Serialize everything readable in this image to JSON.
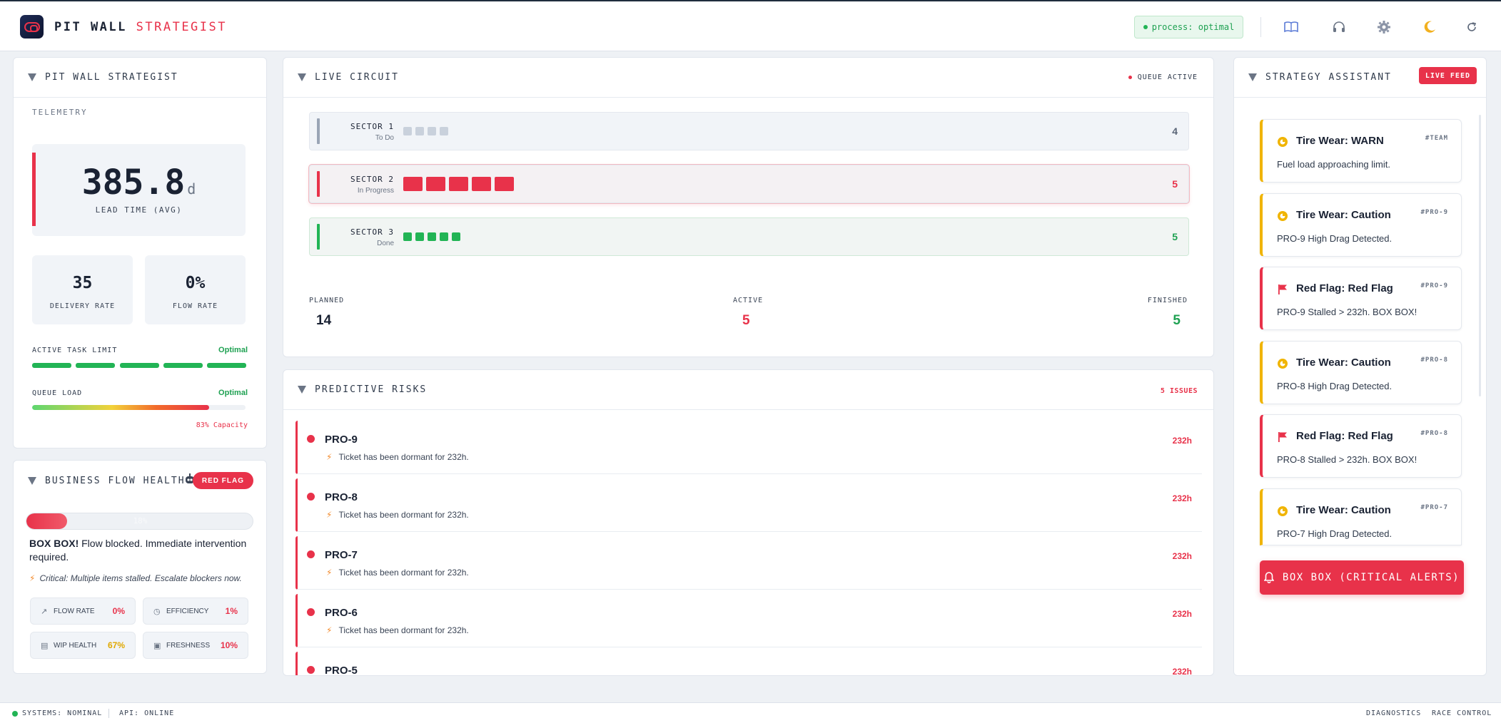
{
  "header": {
    "brand_part1": "PIT WALL",
    "brand_part2": "STRATEGIST",
    "status": "process: optimal"
  },
  "left": {
    "title": "PIT WALL STRATEGIST",
    "telemetry_label": "TELEMETRY",
    "lead_time_value": "385.8",
    "lead_time_unit": "d",
    "lead_time_label": "LEAD TIME (AVG)",
    "delivery_rate_value": "35",
    "delivery_rate_label": "DELIVERY RATE",
    "flow_rate_value": "0%",
    "flow_rate_label": "FLOW RATE",
    "active_task_label": "ACTIVE TASK LIMIT",
    "active_task_status": "Optimal",
    "queue_load_label": "QUEUE LOAD",
    "queue_load_status": "Optimal",
    "queue_capacity_text": "83% Capacity",
    "queue_capacity_fraction": 0.83
  },
  "business": {
    "title": "BUSINESS FLOW HEALTH",
    "badge": "RED FLAG",
    "progress_fraction": 0.18,
    "progress_text": "18%",
    "alert_bold": "BOX BOX!",
    "alert_text": "Flow blocked. Immediate intervention required.",
    "critical_text": "Critical: Multiple items stalled. Escalate blockers now.",
    "metrics": [
      {
        "label": "FLOW RATE",
        "value": "0%",
        "color": "#e8324a"
      },
      {
        "label": "EFFICIENCY",
        "value": "1%",
        "color": "#e8324a"
      },
      {
        "label": "WIP HEALTH",
        "value": "67%",
        "color": "#e0a800"
      },
      {
        "label": "FRESHNESS",
        "value": "10%",
        "color": "#e8324a"
      }
    ]
  },
  "circuit": {
    "title": "LIVE CIRCUIT",
    "queue_status": "QUEUE ACTIVE",
    "sectors": [
      {
        "name": "SECTOR 1",
        "sub": "To Do",
        "count": "4",
        "color": "#c9d1dc",
        "bar_color": "#9aa5b5",
        "count_color": "#5b6678"
      },
      {
        "name": "SECTOR 2",
        "sub": "In Progress",
        "count": "5",
        "color": "#e8324a",
        "bar_color": "#e8324a",
        "count_color": "#e8324a"
      },
      {
        "name": "SECTOR 3",
        "sub": "Done",
        "count": "5",
        "color": "#22b455",
        "bar_color": "#22b455",
        "count_color": "#1fa152"
      }
    ],
    "planned_label": "PLANNED",
    "planned_value": "14",
    "active_label": "ACTIVE",
    "active_value": "5",
    "finished_label": "FINISHED",
    "finished_value": "5"
  },
  "risks": {
    "title": "PREDICTIVE RISKS",
    "issues": "5 ISSUES",
    "items": [
      {
        "name": "PRO-9",
        "desc": "Ticket has been dormant for 232h.",
        "hours": "232h"
      },
      {
        "name": "PRO-8",
        "desc": "Ticket has been dormant for 232h.",
        "hours": "232h"
      },
      {
        "name": "PRO-7",
        "desc": "Ticket has been dormant for 232h.",
        "hours": "232h"
      },
      {
        "name": "PRO-6",
        "desc": "Ticket has been dormant for 232h.",
        "hours": "232h"
      },
      {
        "name": "PRO-5",
        "desc": "",
        "hours": "232h"
      }
    ]
  },
  "assistant": {
    "title": "STRATEGY ASSISTANT",
    "badge": "LIVE FEED",
    "alerts": [
      {
        "kind": "warn",
        "title": "Tire Wear: WARN",
        "tag": "#TEAM",
        "msg": "Fuel load approaching limit."
      },
      {
        "kind": "warn",
        "title": "Tire Wear: Caution",
        "tag": "#PRO-9",
        "msg": "PRO-9 High Drag Detected."
      },
      {
        "kind": "flag",
        "title": "Red Flag: Red Flag",
        "tag": "#PRO-9",
        "msg": "PRO-9 Stalled > 232h. BOX BOX!"
      },
      {
        "kind": "warn",
        "title": "Tire Wear: Caution",
        "tag": "#PRO-8",
        "msg": "PRO-8 High Drag Detected."
      },
      {
        "kind": "flag",
        "title": "Red Flag: Red Flag",
        "tag": "#PRO-8",
        "msg": "PRO-8 Stalled > 232h. BOX BOX!"
      },
      {
        "kind": "warn",
        "title": "Tire Wear: Caution",
        "tag": "#PRO-7",
        "msg": "PRO-7 High Drag Detected."
      }
    ],
    "button": "BOX BOX (CRITICAL ALERTS)"
  },
  "footer": {
    "systems": "SYSTEMS: NOMINAL",
    "api": "API: ONLINE",
    "diagnostics": "DIAGNOSTICS",
    "race_control": "RACE CONTROL"
  }
}
